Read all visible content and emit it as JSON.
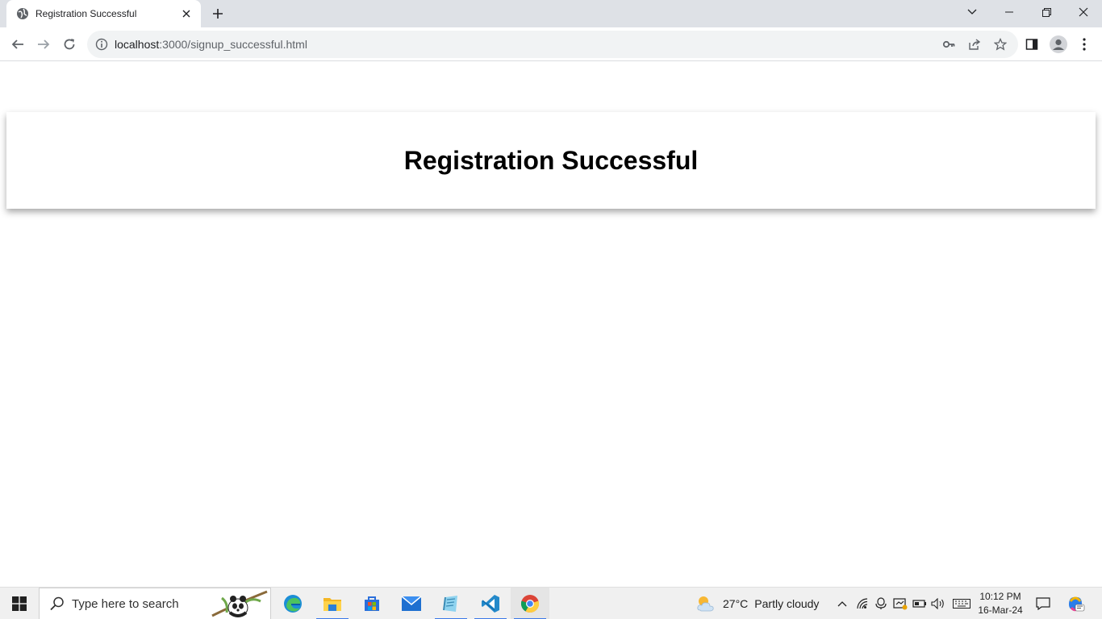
{
  "browser": {
    "tab": {
      "title": "Registration Successful"
    },
    "omnibox": {
      "host": "localhost",
      "path": ":3000/signup_successful.html"
    }
  },
  "page": {
    "heading": "Registration Successful"
  },
  "taskbar": {
    "search_placeholder": "Type here to search",
    "weather": {
      "temp": "27°C",
      "condition": "Partly cloudy"
    },
    "clock": {
      "time": "10:12 PM",
      "date": "16-Mar-24"
    },
    "apps": [
      "edge-icon",
      "file-explorer-icon",
      "store-icon",
      "mail-icon",
      "notepad-icon",
      "vscode-icon",
      "chrome-icon"
    ]
  },
  "colors": {
    "tabstrip": "#dee1e6",
    "omnibox": "#f1f3f4",
    "taskbar": "#f0f0f0",
    "running_indicator": "#3b78e7"
  }
}
